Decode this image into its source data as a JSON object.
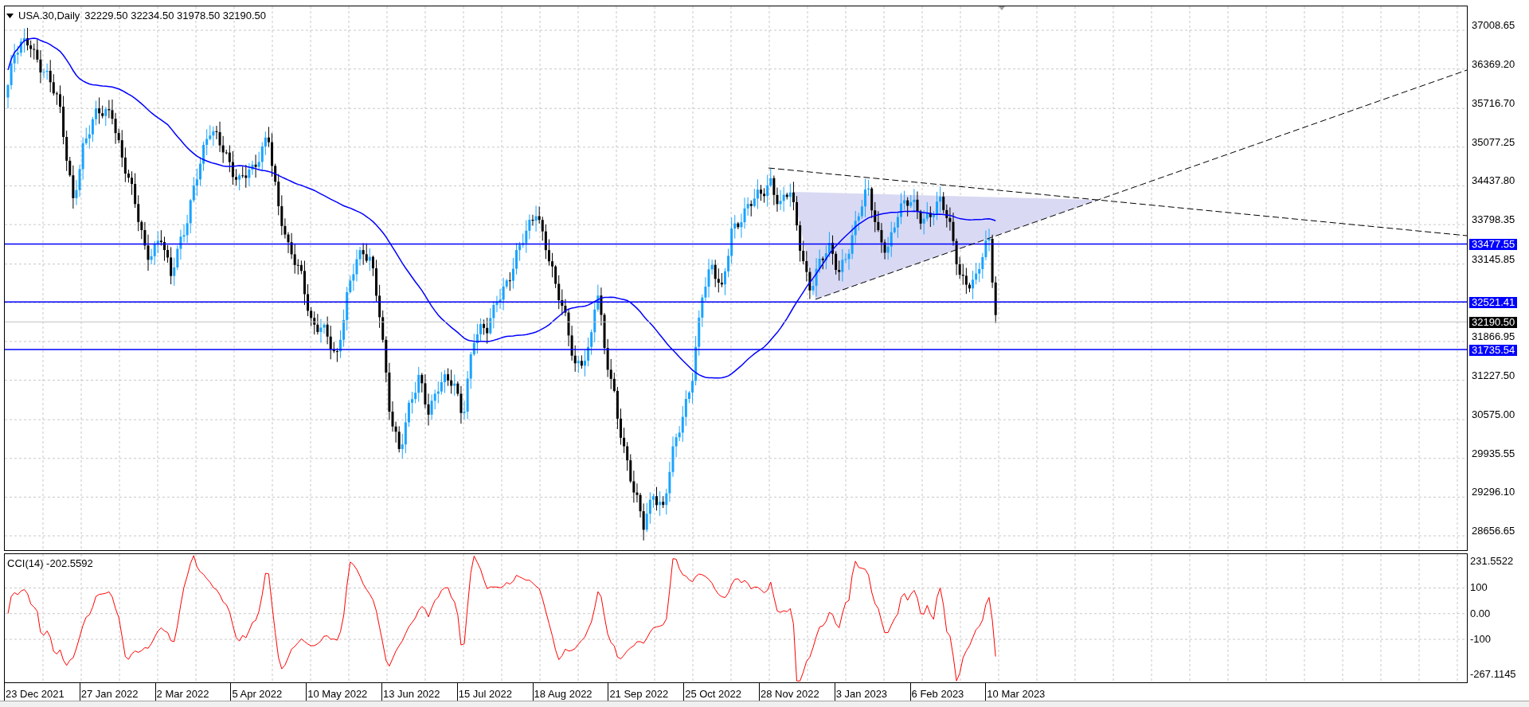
{
  "chart": {
    "title": "USA.30,Daily",
    "ohlc": [
      "32229.50",
      "32234.50",
      "31978.50",
      "32190.50"
    ],
    "price_ticks": [
      "37008.65",
      "36369.20",
      "35716.70",
      "35077.25",
      "34437.80",
      "33798.35",
      "33145.85",
      "31866.95",
      "31227.50",
      "30575.00",
      "29935.55",
      "29296.10",
      "28656.65"
    ],
    "price_levels": [
      {
        "label": "33477.55",
        "kind": "line"
      },
      {
        "label": "32521.41",
        "kind": "line"
      },
      {
        "label": "32190.50",
        "kind": "current"
      },
      {
        "label": "31735.54",
        "kind": "line"
      }
    ]
  },
  "indicator": {
    "label": "CCI(14) -202.5592",
    "scale": [
      "231.5522",
      "100",
      "0.00",
      "-100",
      "-267.1145"
    ]
  },
  "dates": [
    "23 Dec 2021",
    "27 Jan 2022",
    "2 Mar 2022",
    "5 Apr 2022",
    "10 May 2022",
    "13 Jun 2022",
    "15 Jul 2022",
    "18 Aug 2022",
    "21 Sep 2022",
    "25 Oct 2022",
    "28 Nov 2022",
    "3 Jan 2023",
    "6 Feb 2023",
    "10 Mar 2023"
  ]
}
